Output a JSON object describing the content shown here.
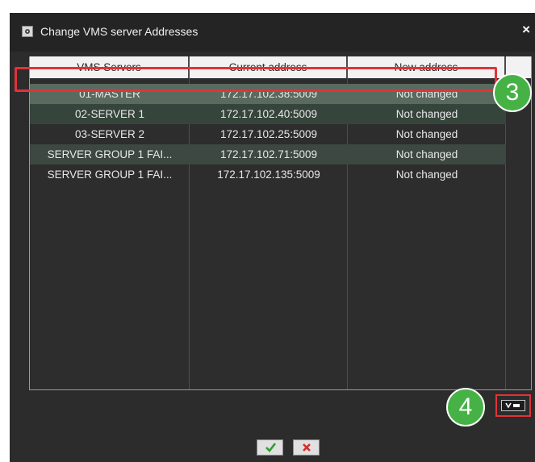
{
  "window": {
    "title": "Change VMS server Addresses",
    "close_glyph": "×",
    "icon": "settings-gear-icon"
  },
  "table": {
    "columns": [
      "VMS Servers",
      "Current address",
      "New address"
    ],
    "rows": [
      {
        "server": "01-MASTER",
        "current": "172.17.102.38:5009",
        "new": "Not changed",
        "selected": true
      },
      {
        "server": "02-SERVER 1",
        "current": "172.17.102.40:5009",
        "new": "Not changed",
        "selected": false
      },
      {
        "server": "03-SERVER 2",
        "current": "172.17.102.25:5009",
        "new": "Not changed",
        "selected": false
      },
      {
        "server": "SERVER GROUP 1 FAI...",
        "current": "172.17.102.71:5009",
        "new": "Not changed",
        "selected": false
      },
      {
        "server": "SERVER GROUP 1 FAI...",
        "current": "172.17.102.135:5009",
        "new": "Not changed",
        "selected": false
      }
    ]
  },
  "callouts": {
    "step3": "3",
    "step4": "4"
  },
  "buttons": {
    "ok_icon": "check-icon",
    "cancel_icon": "x-icon",
    "collapse_icon": "collapse-toggle-icon"
  },
  "colors": {
    "callout_green": "#46b246",
    "highlight_red": "#e0333a",
    "ok_green": "#2f9e2f",
    "cancel_red": "#d03030"
  }
}
